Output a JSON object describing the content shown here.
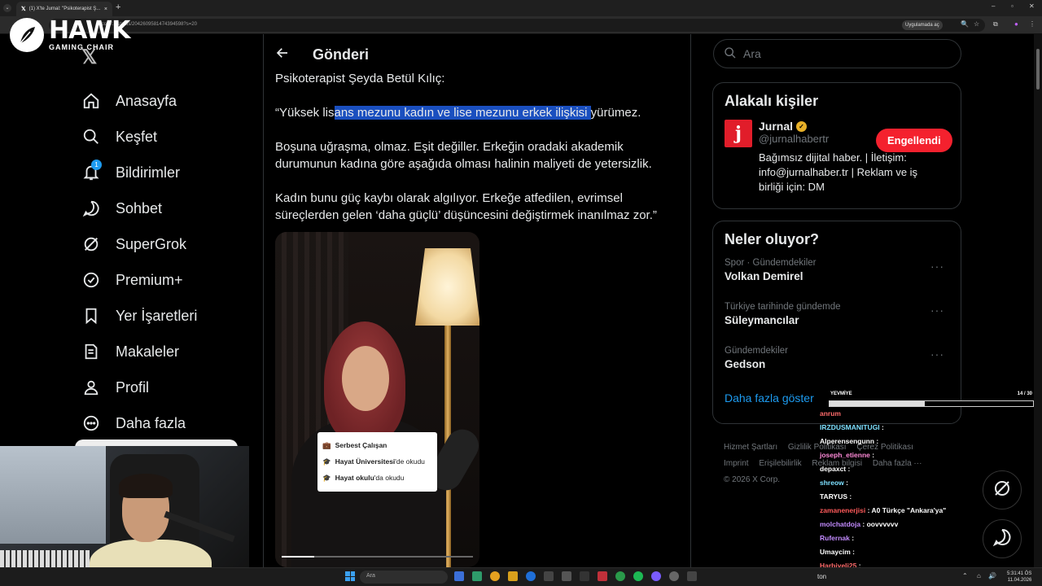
{
  "browser": {
    "tab_title": "(1) X'te Jurnal: \"Psikoterapist Ş...",
    "url": "x.com/.../status/2042609581474394598?s=20",
    "open_in_app": "Uygulamada aç",
    "new_tab": "+"
  },
  "overlay": {
    "brand": "HAWK",
    "brand_sub": "GAMING CHAIR"
  },
  "nav": {
    "items": [
      {
        "label": "Anasayfa",
        "icon": "home-icon"
      },
      {
        "label": "Keşfet",
        "icon": "search-icon"
      },
      {
        "label": "Bildirimler",
        "icon": "bell-icon",
        "badge": "1"
      },
      {
        "label": "Sohbet",
        "icon": "chat-icon"
      },
      {
        "label": "SuperGrok",
        "icon": "grok-icon"
      },
      {
        "label": "Premium+",
        "icon": "verified-icon"
      },
      {
        "label": "Yer İşaretleri",
        "icon": "bookmark-icon"
      },
      {
        "label": "Makaleler",
        "icon": "article-icon"
      },
      {
        "label": "Profil",
        "icon": "profile-icon"
      },
      {
        "label": "Daha fazla",
        "icon": "more-icon"
      }
    ]
  },
  "post": {
    "header": "Gönderi",
    "line1": "Psikoterapist Şeyda Betül Kılıç:",
    "quote_pre": "“Yüksek lis",
    "quote_hl": "ans mezunu kadın ve lise mezunu erkek ilişkisi ",
    "quote_post": "yürümez.",
    "para2": "Boşuna uğraşma, olmaz. Eşit değiller. Erkeğin oradaki akademik durumunun kadına göre aşağıda olması halinin maliyeti de yetersizlik.",
    "para3": "Kadın bunu güç kaybı olarak algılıyor. Erkeğe atfedilen, evrimsel süreçlerden gelen ‘daha güçlü’ düşüncesini değiştirmek inanılmaz zor.”",
    "video_card": [
      {
        "bold": "Serbest Çalışan",
        "rest": ""
      },
      {
        "bold": "Hayat Üniversitesi",
        "rest": "'de okudu"
      },
      {
        "bold": "Hayat okulu",
        "rest": "'da okudu"
      }
    ]
  },
  "sidebar": {
    "search_placeholder": "Ara",
    "related_title": "Alakalı kişiler",
    "person": {
      "name": "Jurnal",
      "handle": "@jurnalhabertr",
      "bio": "Bağımsız dijital haber. | İletişim: info@jurnalhaber.tr | Reklam ve iş birliği için: DM",
      "button": "Engellendi",
      "logo_letter": "j"
    },
    "trends_title": "Neler oluyor?",
    "trends": [
      {
        "meta": "Spor · Gündemdekiler",
        "name": "Volkan Demirel"
      },
      {
        "meta": "Türkiye tarihinde gündemde",
        "name": "Süleymancılar"
      },
      {
        "meta": "Gündemdekiler",
        "name": "Gedson"
      }
    ],
    "show_more": "Daha fazla göster",
    "footer": [
      "Hizmet Şartları",
      "Gizlilik Politikası",
      "Çerez Politikası",
      "Imprint",
      "Erişilebilirlik",
      "Reklam bilgisi",
      "Daha fazla ···",
      "© 2026 X Corp."
    ]
  },
  "stream": {
    "yevmiye_label": "YEVMİYE",
    "yevmiye_count": "14 / 30",
    "yevmiye_progress": 0.467,
    "chat": [
      {
        "user": "anrum",
        "msg": "",
        "color": "#ff6b6b"
      },
      {
        "user": "IRZDUSMANITUGI",
        "msg": ":",
        "color": "#7ee0ff"
      },
      {
        "user": "Alperensengunn",
        "msg": ":",
        "color": "#ffffff"
      },
      {
        "user": "joseph_etienne",
        "msg": ":",
        "color": "#ff8ad8"
      },
      {
        "user": "depaxct",
        "msg": ":",
        "color": "#ffffff"
      },
      {
        "user": "shreow",
        "msg": ":",
        "color": "#7ee0ff"
      },
      {
        "user": "TARYUS",
        "msg": ":",
        "color": "#ffffff"
      },
      {
        "user": "zamanenerjisi",
        "msg": ": A0 Türkçe \"Ankara'ya\"",
        "color": "#ff5a5a"
      },
      {
        "user": "molchatdoja",
        "msg": ": oovvvvvv",
        "color": "#c38bff"
      },
      {
        "user": "Rufernak",
        "msg": ":",
        "color": "#c38bff"
      },
      {
        "user": "Umaycim",
        "msg": ":",
        "color": "#ffffff"
      },
      {
        "user": "Harbiyeli25",
        "msg": ":",
        "color": "#ff6b6b"
      }
    ]
  },
  "taskbar": {
    "search": "Ara",
    "app_text": "ton",
    "time": "5:31:41 ÖS",
    "date": "11.04.2026"
  },
  "colors": {
    "accent": "#1d9bf0",
    "blocked": "#f4212e",
    "highlight": "#1a4fbf"
  }
}
